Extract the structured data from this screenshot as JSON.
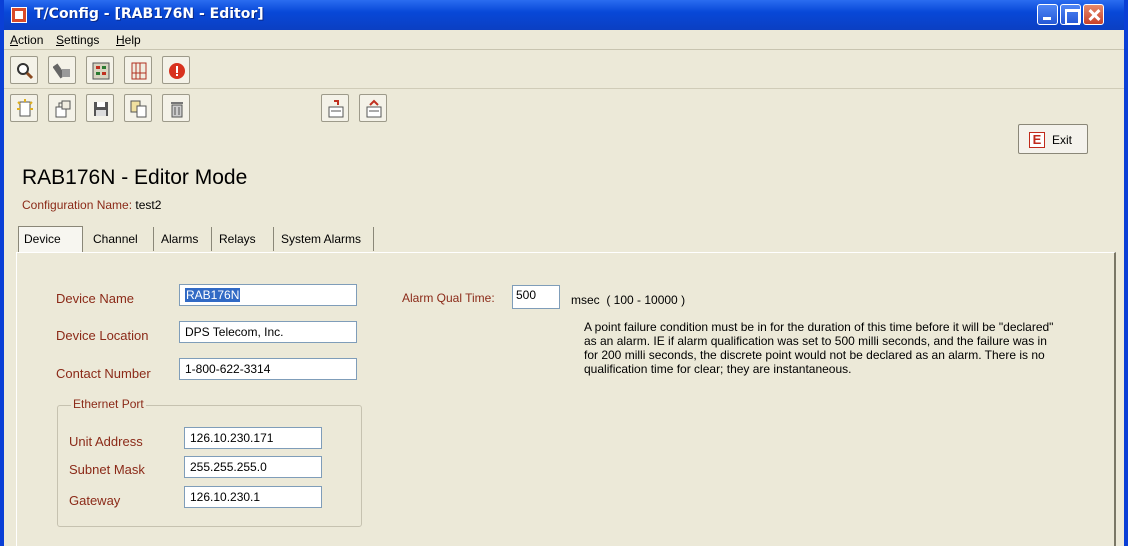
{
  "window": {
    "title": "T/Config - [RAB176N - Editor]"
  },
  "menu": {
    "items": [
      "Action",
      "Settings",
      "Help"
    ]
  },
  "toolbar1": {
    "icons": [
      "magnifier-icon",
      "wrench-icon",
      "grid-chip-icon",
      "building-icon",
      "stop-icon"
    ]
  },
  "toolbar2": {
    "icons": [
      "new-icon",
      "open-icon",
      "save-icon",
      "copy-icon",
      "delete-icon",
      "import-icon",
      "export-icon"
    ]
  },
  "exit": {
    "icon_letter": "E",
    "label": "Exit"
  },
  "page": {
    "title": "RAB176N - Editor Mode",
    "config_label": "Configuration Name:",
    "config_value": "test2"
  },
  "tabs": [
    "Device",
    "Channel",
    "Alarms",
    "Relays",
    "System Alarms"
  ],
  "device": {
    "name_label": "Device Name",
    "name_value": "RAB176N",
    "location_label": "Device Location",
    "location_value": "DPS Telecom, Inc.",
    "contact_label": "Contact Number",
    "contact_value": "1-800-622-3314"
  },
  "ethernet": {
    "group_label": "Ethernet Port",
    "unit_address_label": "Unit Address",
    "unit_address_value": "126.10.230.171",
    "subnet_label": "Subnet Mask",
    "subnet_value": "255.255.255.0",
    "gateway_label": "Gateway",
    "gateway_value": "126.10.230.1"
  },
  "alarm_qual": {
    "label": "Alarm Qual Time:",
    "value": "500",
    "unit": "msec",
    "range": "( 100 - 10000 )",
    "description": "A point failure condition must be in for the duration of this time before it will be \"declared\" as an alarm.  IE if alarm qualification was set to 500 milli seconds, and the failure was in for 200 milli seconds, the discrete point would not be declared as an alarm. There is no qualification time for clear; they are instantaneous."
  }
}
